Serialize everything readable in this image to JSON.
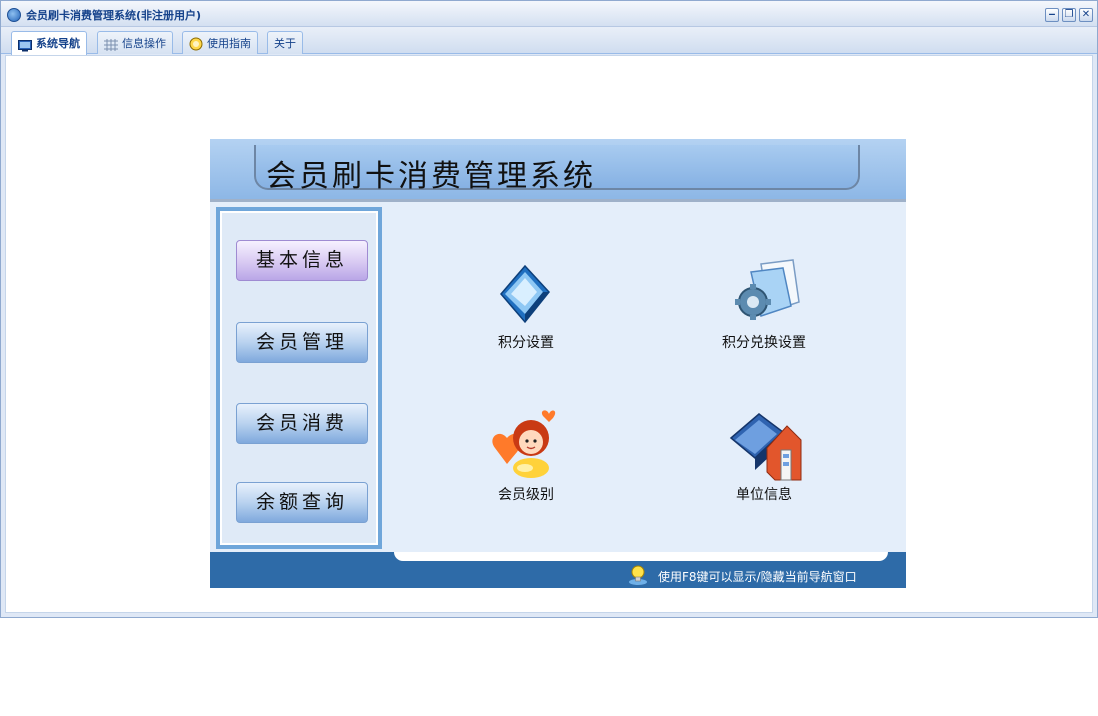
{
  "window": {
    "title": "会员刷卡消费管理系统(非注册用户)",
    "controls": {
      "minimize": "‒",
      "restore": "❐",
      "close": "✕"
    }
  },
  "tabs": [
    {
      "label": "系统导航",
      "icon": "monitor-icon",
      "active": true
    },
    {
      "label": "信息操作",
      "icon": "grid-icon",
      "active": false
    },
    {
      "label": "使用指南",
      "icon": "help-icon",
      "active": false
    },
    {
      "label": "关于",
      "icon": "",
      "active": false
    }
  ],
  "panel": {
    "header_title": "会员刷卡消费管理系统",
    "sidebar": [
      {
        "label": "基本信息",
        "selected": true
      },
      {
        "label": "会员管理",
        "selected": false
      },
      {
        "label": "会员消费",
        "selected": false
      },
      {
        "label": "余额查询",
        "selected": false
      }
    ],
    "features": [
      {
        "label": "积分设置",
        "icon": "book-icon"
      },
      {
        "label": "积分兑换设置",
        "icon": "gear-folder-icon"
      },
      {
        "label": "会员级别",
        "icon": "girl-avatar-icon"
      },
      {
        "label": "单位信息",
        "icon": "house-book-icon"
      }
    ],
    "footer_hint": "使用F8键可以显示/隐藏当前导航窗口"
  },
  "colors": {
    "accent": "#15428b",
    "footer": "#2e6ba8",
    "sidebar": "#6fa6da",
    "panel_bg": "#e4eefa"
  }
}
